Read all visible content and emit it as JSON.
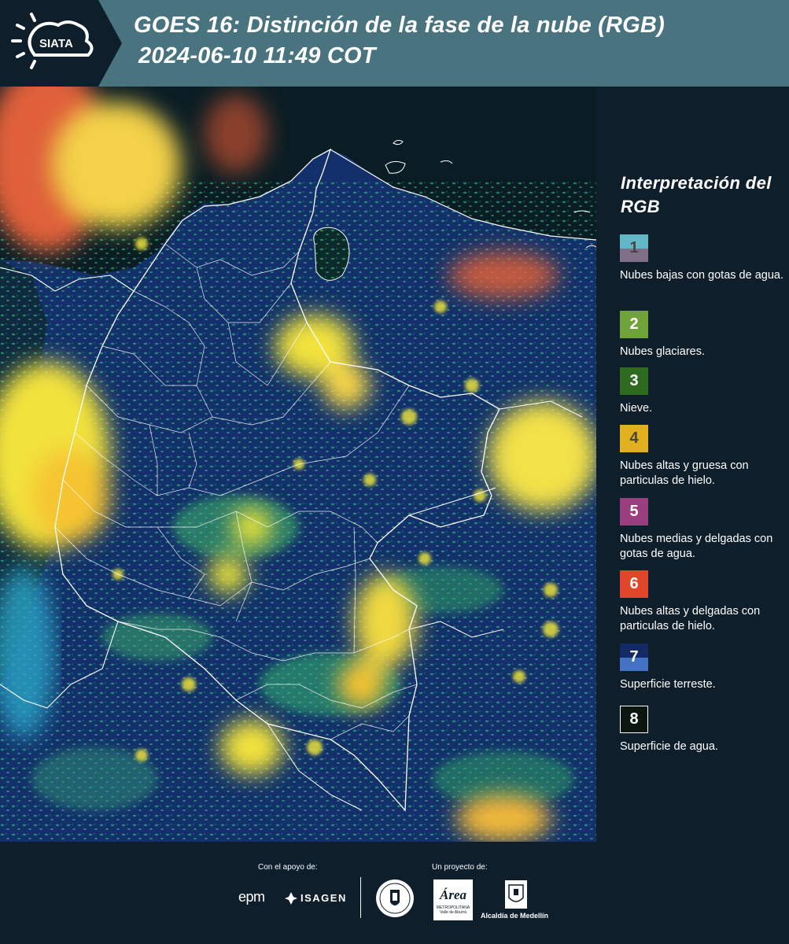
{
  "header": {
    "logo_text": "SIATA",
    "title_line1": "GOES 16: Distinción de la fase de la nube (RGB)",
    "title_line2": "2024-06-10 11:49 COT"
  },
  "colors": {
    "header_bg": "#4a7380",
    "panel_bg": "#0e1e2b",
    "cloud_yellow": "#f6e43a",
    "cloud_green": "#5fd27a",
    "land_blue": "#1c3f86",
    "sea_dark": "#0b1a1c"
  },
  "legend": {
    "title": "Interpretación del RGB",
    "items": [
      {
        "number": "1",
        "label": "Nubes bajas con gotas de agua.",
        "color_top": "#62b7c6",
        "color_bottom": "#7f6f88",
        "number_color": "#444444"
      },
      {
        "number": "2",
        "label": "Nubes glaciares.",
        "color": "#6fa33a",
        "number_color": "#ffffff"
      },
      {
        "number": "3",
        "label": "Nieve.",
        "color": "#2f6b1f",
        "number_color": "#ffffff"
      },
      {
        "number": "4",
        "label": "Nubes altas y gruesa con particulas de hielo.",
        "color": "#e0b01e",
        "number_color": "#444444"
      },
      {
        "number": "5",
        "label": "Nubes medias y delgadas con gotas de agua.",
        "color": "#9a3f7e",
        "number_color": "#ffffff"
      },
      {
        "number": "6",
        "label": "Nubes altas y delgadas con particulas de hielo.",
        "color": "#e0462a",
        "number_color": "#ffffff"
      },
      {
        "number": "7",
        "label": "Superficie terreste.",
        "color_top": "#132a66",
        "color_bottom": "#4472c4",
        "number_color": "#ffffff"
      },
      {
        "number": "8",
        "label": "Superficie de agua.",
        "color": "#0b160e",
        "number_color": "#ffffff"
      }
    ]
  },
  "footer": {
    "support_label": "Con el apoyo de:",
    "project_label": "Un proyecto de:",
    "epm": "epm",
    "isagen": "ISAGEN",
    "area_title": "Área",
    "area_sub": "METROPOLITANA Valle de Aburrá",
    "alcaldia": "Alcaldía de Medellín"
  }
}
